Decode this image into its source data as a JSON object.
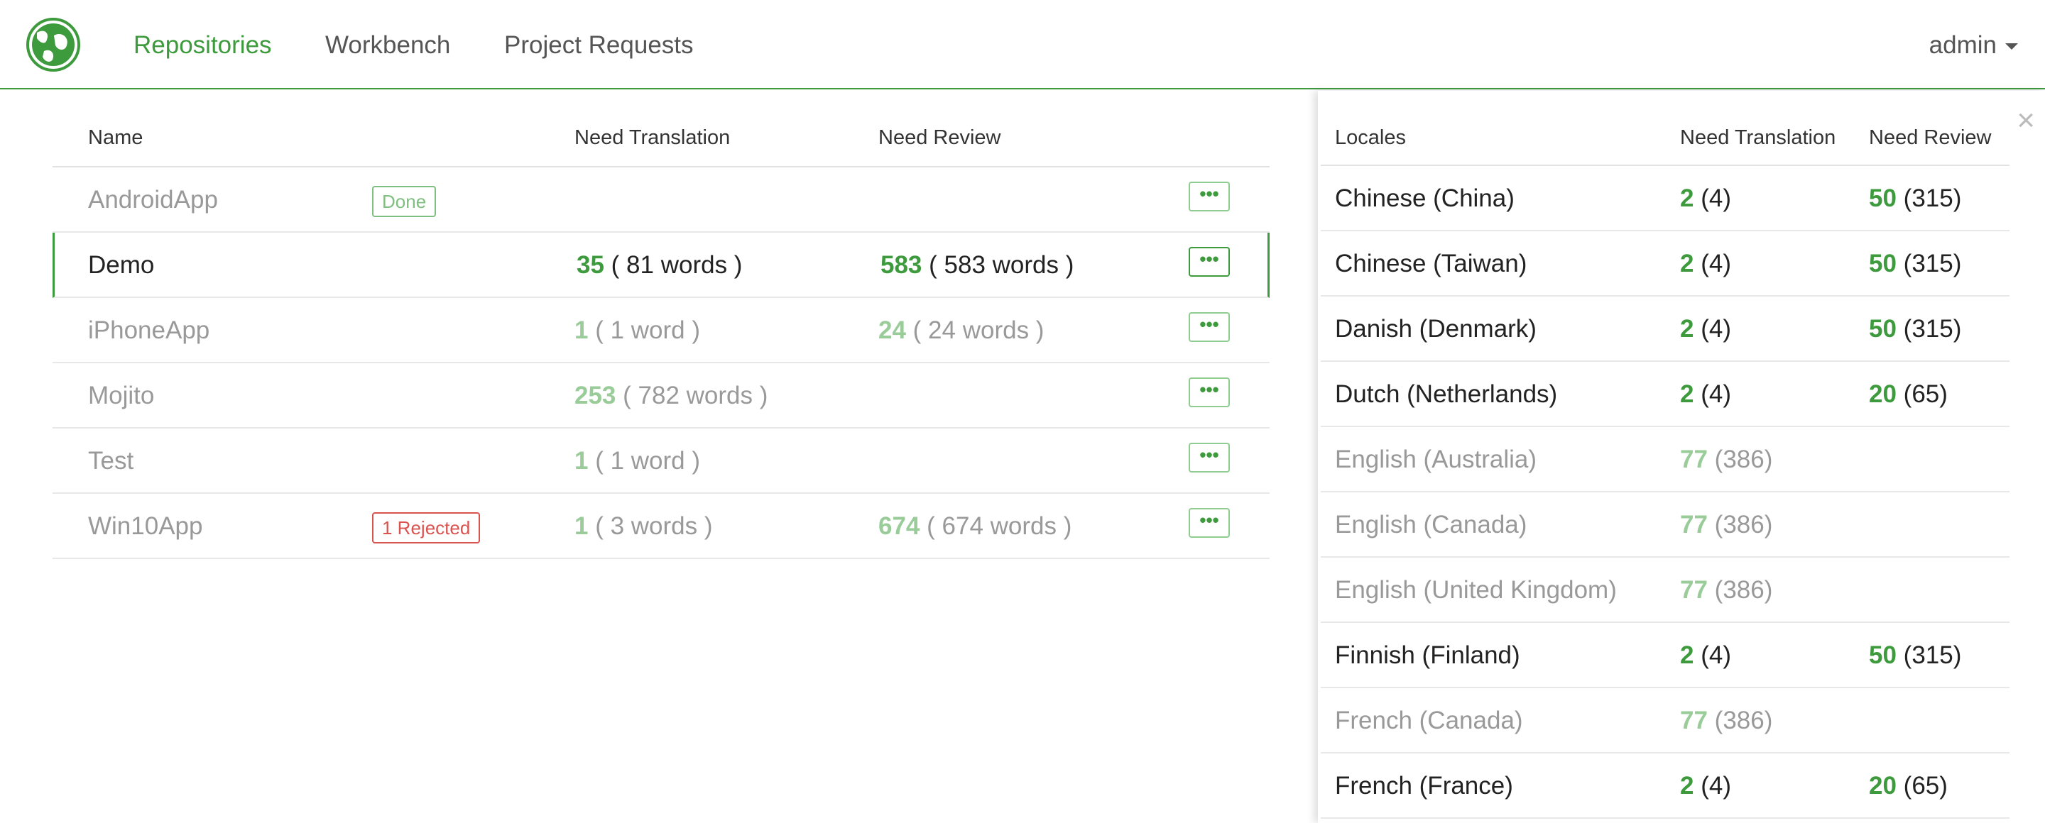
{
  "colors": {
    "accent": "#3d9a3d",
    "accent_light": "#99cc99",
    "rejected": "#d9534f",
    "muted_text": "#999999"
  },
  "nav": {
    "logo_icon": "globe-leaf-icon",
    "links": [
      "Repositories",
      "Workbench",
      "Project Requests"
    ],
    "active": "Repositories",
    "user": "admin"
  },
  "repositories": {
    "headers": {
      "name": "Name",
      "need_translation": "Need Translation",
      "need_review": "Need Review"
    },
    "rows": [
      {
        "name": "AndroidApp",
        "badge": "Done",
        "badge_type": "done",
        "nt_count": "",
        "nt_words": "",
        "nr_count": "",
        "nr_words": "",
        "more": "•••",
        "state": "muted"
      },
      {
        "name": "Demo",
        "badge": "",
        "badge_type": "",
        "nt_count": "35",
        "nt_words": "( 81 words )",
        "nr_count": "583",
        "nr_words": "( 583 words )",
        "more": "•••",
        "state": "selected"
      },
      {
        "name": "iPhoneApp",
        "badge": "",
        "badge_type": "",
        "nt_count": "1",
        "nt_words": "( 1 word )",
        "nr_count": "24",
        "nr_words": "( 24 words )",
        "more": "•••",
        "state": "muted"
      },
      {
        "name": "Mojito",
        "badge": "",
        "badge_type": "",
        "nt_count": "253",
        "nt_words": "( 782 words )",
        "nr_count": "",
        "nr_words": "",
        "more": "•••",
        "state": "muted"
      },
      {
        "name": "Test",
        "badge": "",
        "badge_type": "",
        "nt_count": "1",
        "nt_words": "( 1 word )",
        "nr_count": "",
        "nr_words": "",
        "more": "•••",
        "state": "muted"
      },
      {
        "name": "Win10App",
        "badge": "1 Rejected",
        "badge_type": "rejected",
        "nt_count": "1",
        "nt_words": "( 3 words )",
        "nr_count": "674",
        "nr_words": "( 674 words )",
        "more": "•••",
        "state": "muted"
      }
    ]
  },
  "locales": {
    "close_label": "×",
    "headers": {
      "locale": "Locales",
      "need_translation": "Need Translation",
      "need_review": "Need Review"
    },
    "rows": [
      {
        "name": "Chinese (China)",
        "nt_count": "2",
        "nt_words": "(4)",
        "nr_count": "50",
        "nr_words": "(315)",
        "state": "dark"
      },
      {
        "name": "Chinese (Taiwan)",
        "nt_count": "2",
        "nt_words": "(4)",
        "nr_count": "50",
        "nr_words": "(315)",
        "state": "dark"
      },
      {
        "name": "Danish (Denmark)",
        "nt_count": "2",
        "nt_words": "(4)",
        "nr_count": "50",
        "nr_words": "(315)",
        "state": "dark"
      },
      {
        "name": "Dutch (Netherlands)",
        "nt_count": "2",
        "nt_words": "(4)",
        "nr_count": "20",
        "nr_words": "(65)",
        "state": "dark"
      },
      {
        "name": "English (Australia)",
        "nt_count": "77",
        "nt_words": "(386)",
        "nr_count": "",
        "nr_words": "",
        "state": "muted"
      },
      {
        "name": "English (Canada)",
        "nt_count": "77",
        "nt_words": "(386)",
        "nr_count": "",
        "nr_words": "",
        "state": "muted"
      },
      {
        "name": "English (United Kingdom)",
        "nt_count": "77",
        "nt_words": "(386)",
        "nr_count": "",
        "nr_words": "",
        "state": "muted"
      },
      {
        "name": "Finnish (Finland)",
        "nt_count": "2",
        "nt_words": "(4)",
        "nr_count": "50",
        "nr_words": "(315)",
        "state": "dark"
      },
      {
        "name": "French (Canada)",
        "nt_count": "77",
        "nt_words": "(386)",
        "nr_count": "",
        "nr_words": "",
        "state": "muted"
      },
      {
        "name": "French (France)",
        "nt_count": "2",
        "nt_words": "(4)",
        "nr_count": "20",
        "nr_words": "(65)",
        "state": "dark"
      }
    ]
  }
}
